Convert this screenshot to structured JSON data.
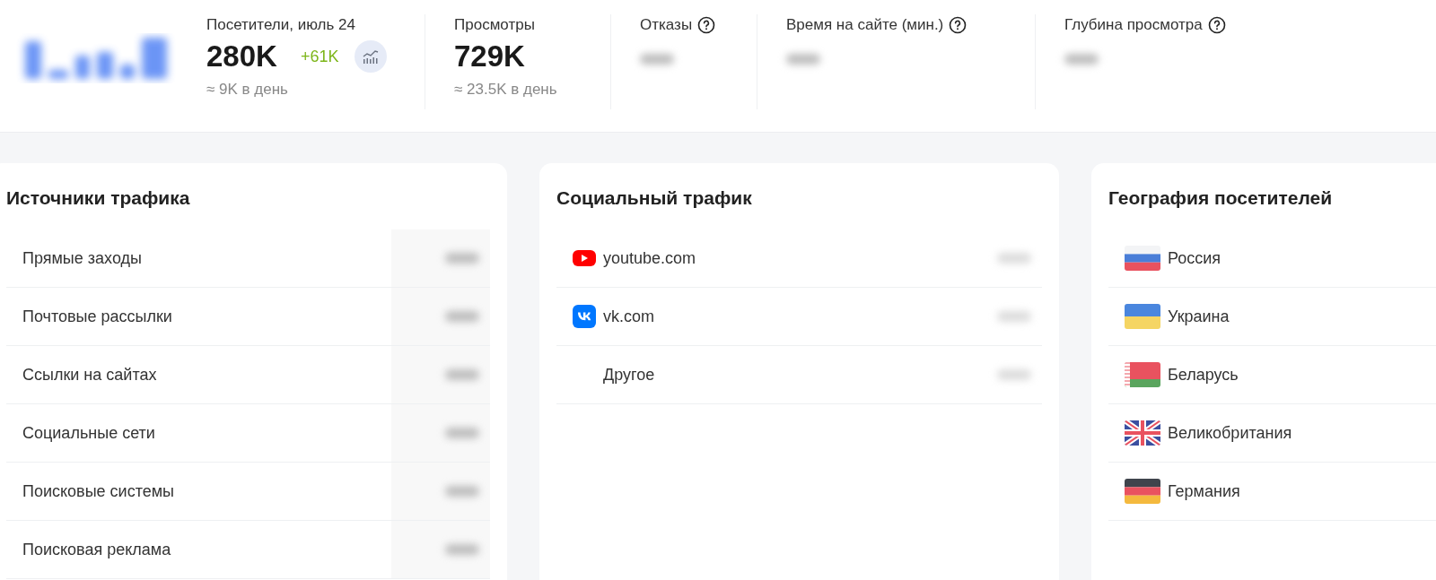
{
  "metrics": [
    {
      "title": "Посетители, июль 24",
      "value": "280K",
      "delta": "+61K",
      "chart_button": true,
      "per_day": "≈ 9K в день"
    },
    {
      "title": "Просмотры",
      "value": "729K",
      "per_day": "≈ 23.5K в день"
    },
    {
      "title": "Отказы",
      "help": true,
      "hidden_value": true
    },
    {
      "title": "Время на сайте (мин.)",
      "help": true,
      "hidden_value": true
    },
    {
      "title": "Глубина просмотра",
      "help": true,
      "hidden_value": true
    }
  ],
  "cards": [
    {
      "title": "Источники трафика",
      "kind": "sources",
      "rows": [
        {
          "label": "Прямые заходы",
          "kind": "plain"
        },
        {
          "label": "Почтовые рассылки",
          "kind": "plain"
        },
        {
          "label": "Ссылки на сайтах",
          "kind": "plain"
        },
        {
          "label": "Социальные сети",
          "kind": "plain"
        },
        {
          "label": "Поисковые системы",
          "kind": "plain"
        },
        {
          "label": "Поисковая реклама",
          "kind": "plain"
        }
      ]
    },
    {
      "title": "Социальный трафик",
      "kind": "social",
      "rows": [
        {
          "label": "youtube.com",
          "kind": "youtube"
        },
        {
          "label": "vk.com",
          "kind": "vk"
        },
        {
          "label": "Другое",
          "kind": "none"
        }
      ]
    },
    {
      "title": "География посетителей",
      "kind": "geo",
      "rows": [
        {
          "label": "Россия",
          "kind": "ru"
        },
        {
          "label": "Украина",
          "kind": "ua"
        },
        {
          "label": "Беларусь",
          "kind": "by"
        },
        {
          "label": "Великобритания",
          "kind": "gb"
        },
        {
          "label": "Германия",
          "kind": "de"
        }
      ]
    }
  ]
}
